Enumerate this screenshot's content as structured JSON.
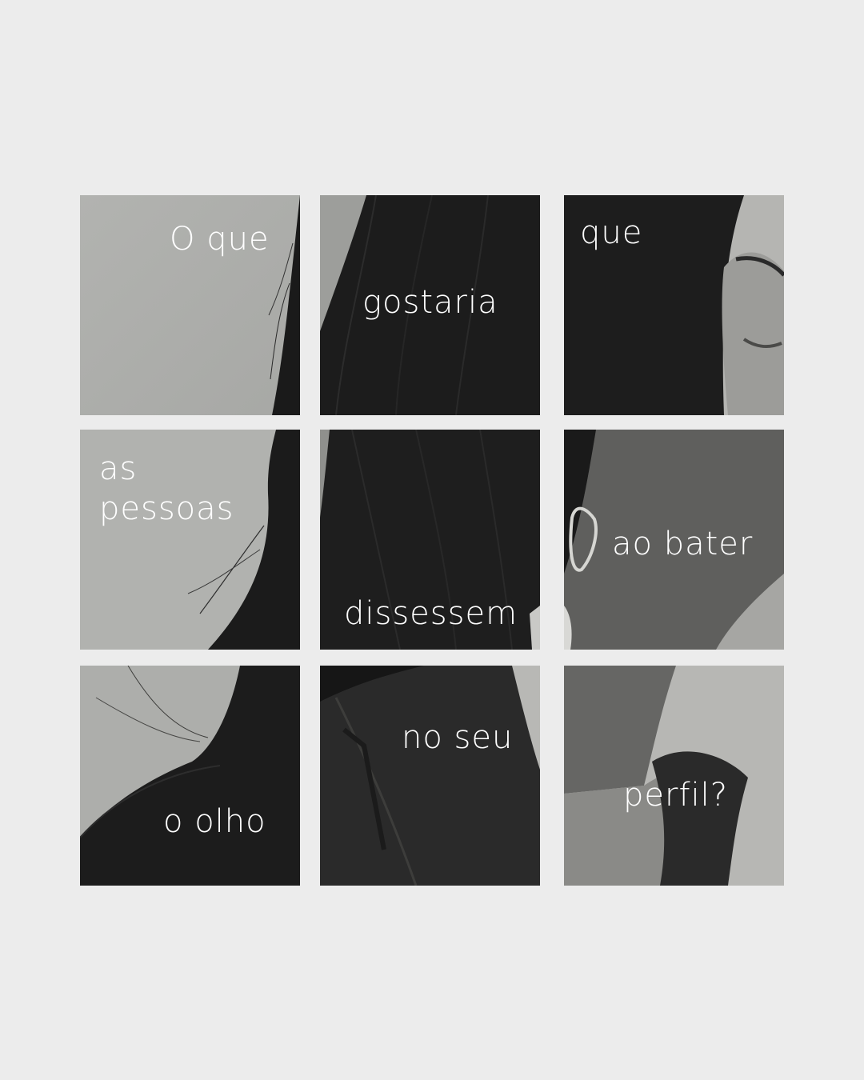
{
  "background_color": "#ececec",
  "text_color": "#ffffff",
  "tiles": [
    {
      "words": [
        "O que"
      ]
    },
    {
      "words": [
        "gostaria"
      ]
    },
    {
      "words": [
        "que"
      ]
    },
    {
      "words": [
        "as",
        "pessoas"
      ]
    },
    {
      "words": [
        "dissessem"
      ]
    },
    {
      "words": [
        "ao bater"
      ]
    },
    {
      "words": [
        "o olho"
      ]
    },
    {
      "words": [
        "no seu"
      ]
    },
    {
      "words": [
        "perfil?"
      ]
    }
  ]
}
